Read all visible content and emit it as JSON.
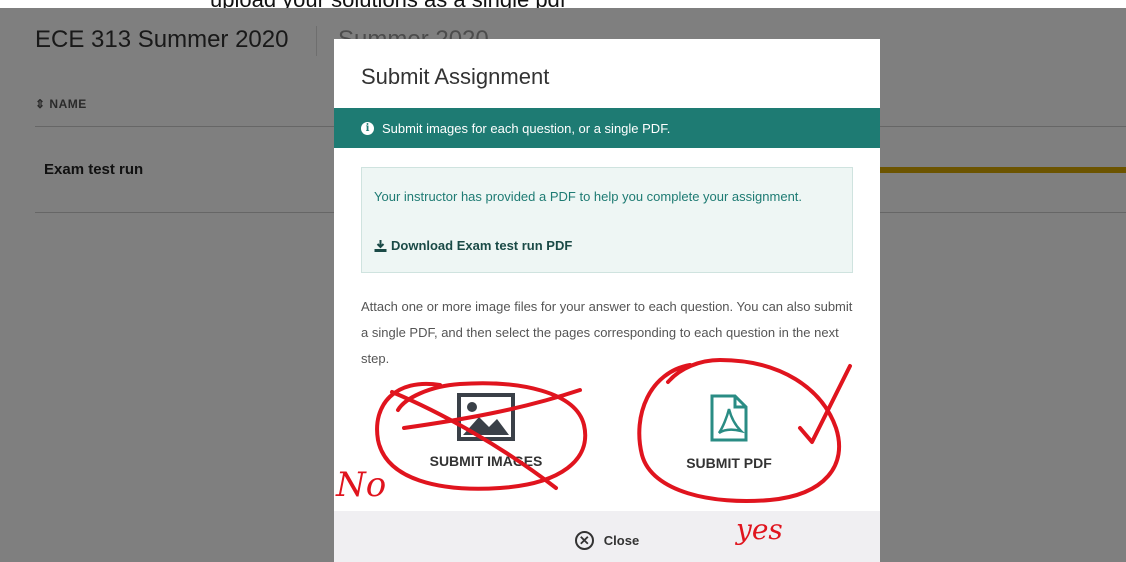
{
  "header": {
    "course_title": "ECE 313 Summer 2020",
    "term": "Summer 2020",
    "top_cut_text": "upload your solutions as a single pdf"
  },
  "table": {
    "sort_icon": "sort-icon",
    "column_name": "NAME",
    "rows": [
      {
        "name": "Exam test run",
        "progress_color": "#d9a800"
      }
    ]
  },
  "modal": {
    "title": "Submit Assignment",
    "banner": {
      "icon": "info-icon",
      "icon_glyph": "i",
      "text": "Submit images for each question, or a single PDF.",
      "color": "#1e7b73"
    },
    "notice": {
      "text": "Your instructor has provided a PDF to help you complete your assignment.",
      "download_icon": "download-icon",
      "download_label": "Download Exam test run PDF"
    },
    "instructions": "Attach one or more image files for your answer to each question. You can also submit a single PDF, and then select the pages corresponding to each question in the next step.",
    "options": {
      "images": {
        "icon": "image-icon",
        "label": "SUBMIT IMAGES"
      },
      "pdf": {
        "icon": "pdf-file-icon",
        "label": "SUBMIT PDF"
      }
    },
    "footer": {
      "close_icon": "close-circle-icon",
      "close_glyph": "✕",
      "close_label": "Close"
    }
  },
  "annotations": {
    "color": "#e0141e",
    "no_text": "No",
    "yes_text": "yes"
  }
}
